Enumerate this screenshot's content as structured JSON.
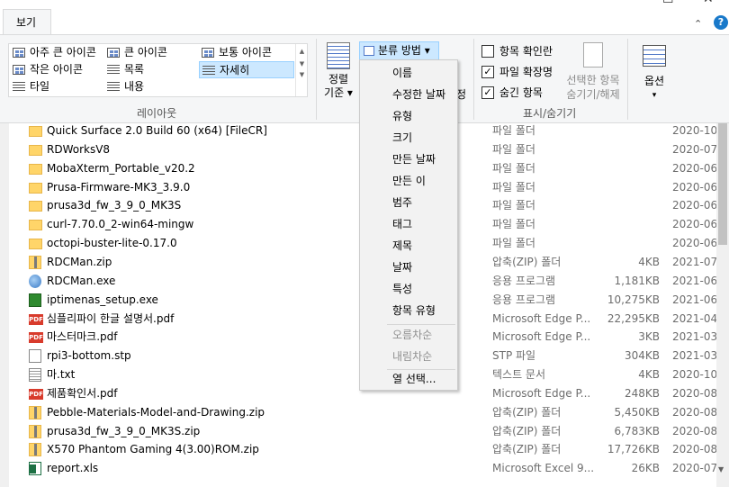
{
  "window": {
    "minimize": "—",
    "maximize": "☐",
    "close": "✕"
  },
  "ribbon": {
    "tab_view": "보기",
    "up_arrow": "⌃",
    "help": "?",
    "layout": {
      "group_label": "레이아웃",
      "items": [
        {
          "label": "아주 큰 아이콘"
        },
        {
          "label": "큰 아이콘"
        },
        {
          "label": "보통 아이콘"
        },
        {
          "label": "작은 아이콘"
        },
        {
          "label": "목록"
        },
        {
          "label": "자세히"
        },
        {
          "label": "타일"
        },
        {
          "label": "내용"
        }
      ],
      "selected": "자세히"
    },
    "sort": {
      "line1": "정렬",
      "line2": "기준 ▾"
    },
    "group_by": {
      "label": "분류 방법 ▾"
    },
    "hidden_partial": "정",
    "show_hide": {
      "group_label": "표시/숨기기",
      "item_checkbox": {
        "label": "항목 확인란",
        "checked": false
      },
      "file_extension": {
        "label": "파일 확장명",
        "checked": true
      },
      "hidden_items": {
        "label": "숨긴 항목",
        "checked": true
      },
      "hide_selected_line1": "선택한 항목",
      "hide_selected_line2": "숨기기/해제"
    },
    "options": {
      "label": "옵션",
      "arrow": "▾"
    }
  },
  "menu": {
    "items": [
      {
        "label": "이름",
        "disabled": false
      },
      {
        "label": "수정한 날짜",
        "disabled": false
      },
      {
        "label": "유형",
        "disabled": false
      },
      {
        "label": "크기",
        "disabled": false
      },
      {
        "label": "만든 날짜",
        "disabled": false
      },
      {
        "label": "만든 이",
        "disabled": false
      },
      {
        "label": "범주",
        "disabled": false
      },
      {
        "label": "태그",
        "disabled": false
      },
      {
        "label": "제목",
        "disabled": false
      },
      {
        "label": "날짜",
        "disabled": false
      },
      {
        "label": "특성",
        "disabled": false
      },
      {
        "label": "항목 유형",
        "disabled": false
      },
      {
        "label": "오름차순",
        "disabled": true
      },
      {
        "label": "내림차순",
        "disabled": true
      },
      {
        "label": "열 선택...",
        "disabled": false
      }
    ]
  },
  "files": [
    {
      "icon": "folder-icon",
      "name": "Quick Surface 2.0 Build 60 (x64) [FileCR]",
      "type": "파일 폴더",
      "size": "",
      "date": "2020-10"
    },
    {
      "icon": "folder-icon",
      "name": "RDWorksV8",
      "type": "파일 폴더",
      "size": "",
      "date": "2020-07"
    },
    {
      "icon": "folder-icon",
      "name": "MobaXterm_Portable_v20.2",
      "type": "파일 폴더",
      "size": "",
      "date": "2020-06"
    },
    {
      "icon": "folder-icon",
      "name": "Prusa-Firmware-MK3_3.9.0",
      "type": "파일 폴더",
      "size": "",
      "date": "2020-06"
    },
    {
      "icon": "folder-icon",
      "name": "prusa3d_fw_3_9_0_MK3S",
      "type": "파일 폴더",
      "size": "",
      "date": "2020-06"
    },
    {
      "icon": "folder-icon",
      "name": "curl-7.70.0_2-win64-mingw",
      "type": "파일 폴더",
      "size": "",
      "date": "2020-06"
    },
    {
      "icon": "folder-icon",
      "name": "octopi-buster-lite-0.17.0",
      "type": "파일 폴더",
      "size": "",
      "date": "2020-06"
    },
    {
      "icon": "zip-icon",
      "name": "RDCMan.zip",
      "type": "압축(ZIP) 폴더",
      "size": "4KB",
      "date": "2021-07"
    },
    {
      "icon": "exe-icon",
      "name": "RDCMan.exe",
      "type": "응용 프로그램",
      "size": "1,181KB",
      "date": "2021-06"
    },
    {
      "icon": "setup-icon",
      "name": "iptimenas_setup.exe",
      "type": "응용 프로그램",
      "size": "10,275KB",
      "date": "2021-06"
    },
    {
      "icon": "pdf-icon",
      "name": "심플리파이 한글 설명서.pdf",
      "type": "Microsoft Edge P...",
      "size": "22,295KB",
      "date": "2021-04"
    },
    {
      "icon": "pdf-icon",
      "name": "마스터마크.pdf",
      "type": "Microsoft Edge P...",
      "size": "3KB",
      "date": "2021-03"
    },
    {
      "icon": "doc-icon",
      "name": "rpi3-bottom.stp",
      "type": "STP 파일",
      "size": "304KB",
      "date": "2021-03"
    },
    {
      "icon": "txt-icon",
      "name": "마.txt",
      "type": "텍스트 문서",
      "size": "4KB",
      "date": "2020-10"
    },
    {
      "icon": "pdf-icon",
      "name": "제품확인서.pdf",
      "type": "Microsoft Edge P...",
      "size": "248KB",
      "date": "2020-08"
    },
    {
      "icon": "zip-icon",
      "name": "Pebble-Materials-Model-and-Drawing.zip",
      "type": "압축(ZIP) 폴더",
      "size": "5,450KB",
      "date": "2020-08"
    },
    {
      "icon": "zip-icon",
      "name": "prusa3d_fw_3_9_0_MK3S.zip",
      "type": "압축(ZIP) 폴더",
      "size": "6,783KB",
      "date": "2020-08"
    },
    {
      "icon": "zip-icon",
      "name": "X570 Phantom Gaming 4(3.00)ROM.zip",
      "type": "압축(ZIP) 폴더",
      "size": "17,726KB",
      "date": "2020-08"
    },
    {
      "icon": "xls-icon",
      "name": "report.xls",
      "type": "Microsoft Excel 9...",
      "size": "26KB",
      "date": "2020-07"
    }
  ],
  "scroll": {
    "down": "▼"
  },
  "colors": {
    "selection": "#cce8ff",
    "selection_border": "#99d1ff",
    "ribbon_bg": "#f5f6f7",
    "folder": "#ffd569",
    "pdf": "#d83b2c"
  }
}
